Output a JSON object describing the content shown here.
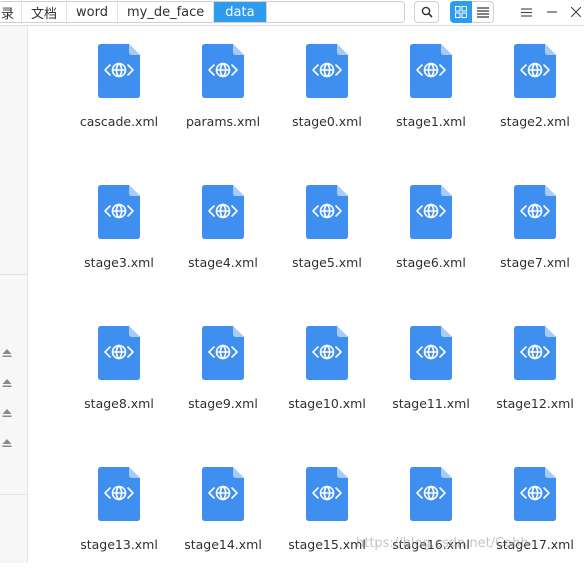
{
  "breadcrumbs": [
    "录",
    "文档",
    "word",
    "my_de_face",
    "data"
  ],
  "icons": {
    "search": "search-icon",
    "grid": "grid-view-icon",
    "list": "list-view-icon",
    "menu": "menu-icon",
    "minimize": "minimize-icon",
    "close": "close-icon",
    "eject": "eject-icon",
    "file": "xml-file-icon"
  },
  "colors": {
    "accent": "#2d9cee",
    "file_icon": "#3f8ff0",
    "file_icon_fold": "#a9ccf7"
  },
  "files": [
    "cascade.xml",
    "params.xml",
    "stage0.xml",
    "stage1.xml",
    "stage2.xml",
    "stage3.xml",
    "stage4.xml",
    "stage5.xml",
    "stage6.xml",
    "stage7.xml",
    "stage8.xml",
    "stage9.xml",
    "stage10.xml",
    "stage11.xml",
    "stage12.xml",
    "stage13.xml",
    "stage14.xml",
    "stage15.xml",
    "stage16.xml",
    "stage17.xml"
  ],
  "watermark": "https://blog.csdn.net/Cobb"
}
